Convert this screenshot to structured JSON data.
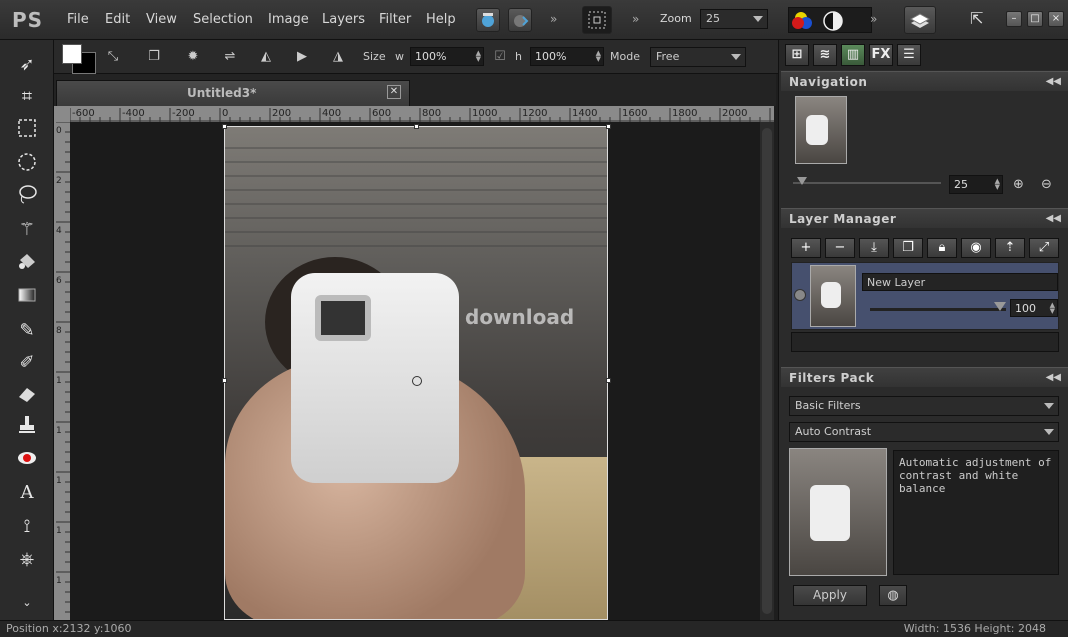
{
  "app": {
    "logo": "PS",
    "menu": [
      "File",
      "Edit",
      "View",
      "Selection",
      "Image",
      "Layers",
      "Filter",
      "Help"
    ],
    "zoom_label": "Zoom",
    "zoom_value": "25"
  },
  "options": {
    "size_label": "Size",
    "w_label": "w",
    "w_value": "100%",
    "h_label": "h",
    "h_value": "100%",
    "mode_label": "Mode",
    "mode_value": "Free"
  },
  "document": {
    "tab_title": "Untitled3*",
    "ruler_h": [
      "-600",
      "-400",
      "-200",
      "0",
      "200",
      "400",
      "600",
      "800",
      "1000",
      "1200",
      "1400",
      "1600",
      "1800",
      "2000"
    ],
    "ruler_v": [
      "0",
      "2",
      "4",
      "6",
      "8",
      "1",
      "1",
      "1",
      "1",
      "1"
    ],
    "watermark": "download"
  },
  "status": {
    "position": "Position  x:2132 y:1060",
    "dimensions": "Width: 1536 Height: 2048"
  },
  "panels": {
    "navigation": {
      "title": "Navigation",
      "zoom_value": "25"
    },
    "layer_manager": {
      "title": "Layer Manager",
      "layer_name": "New Layer",
      "opacity": "100"
    },
    "filters_pack": {
      "title": "Filters Pack",
      "category": "Basic Filters",
      "filter": "Auto Contrast",
      "description": "Automatic adjustment of contrast and white balance",
      "apply_label": "Apply"
    },
    "tabs": [
      "FX"
    ]
  },
  "colors": {
    "accent_layer_row": "#46506e",
    "background": "#1e1e1e"
  }
}
